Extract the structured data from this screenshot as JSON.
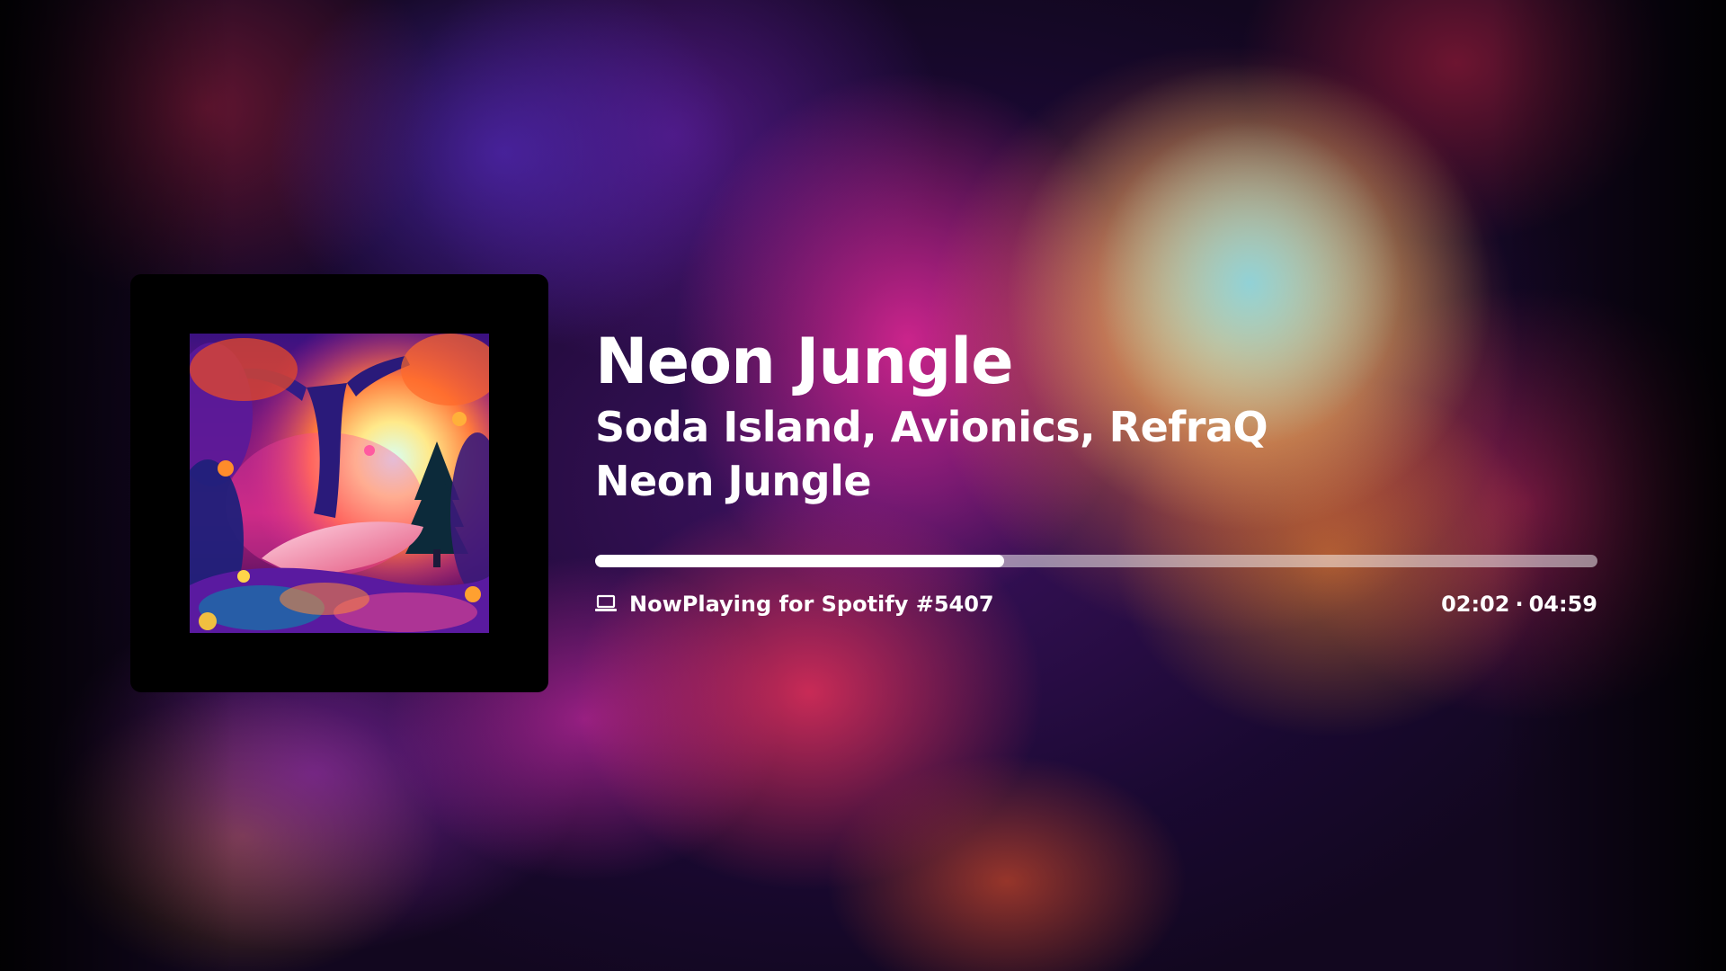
{
  "track": {
    "title": "Neon Jungle",
    "artists": "Soda Island, Avionics, RefraQ",
    "album": "Neon Jungle"
  },
  "playback": {
    "elapsed": "02:02",
    "separator": "·",
    "duration": "04:59",
    "progress_fraction": 0.408
  },
  "device": {
    "icon": "laptop-icon",
    "name": "NowPlaying for Spotify #5407"
  },
  "colors": {
    "text": "#ffffff",
    "progress_track": "rgba(255,255,255,0.5)",
    "progress_fill": "#ffffff",
    "card_background": "#000000"
  }
}
